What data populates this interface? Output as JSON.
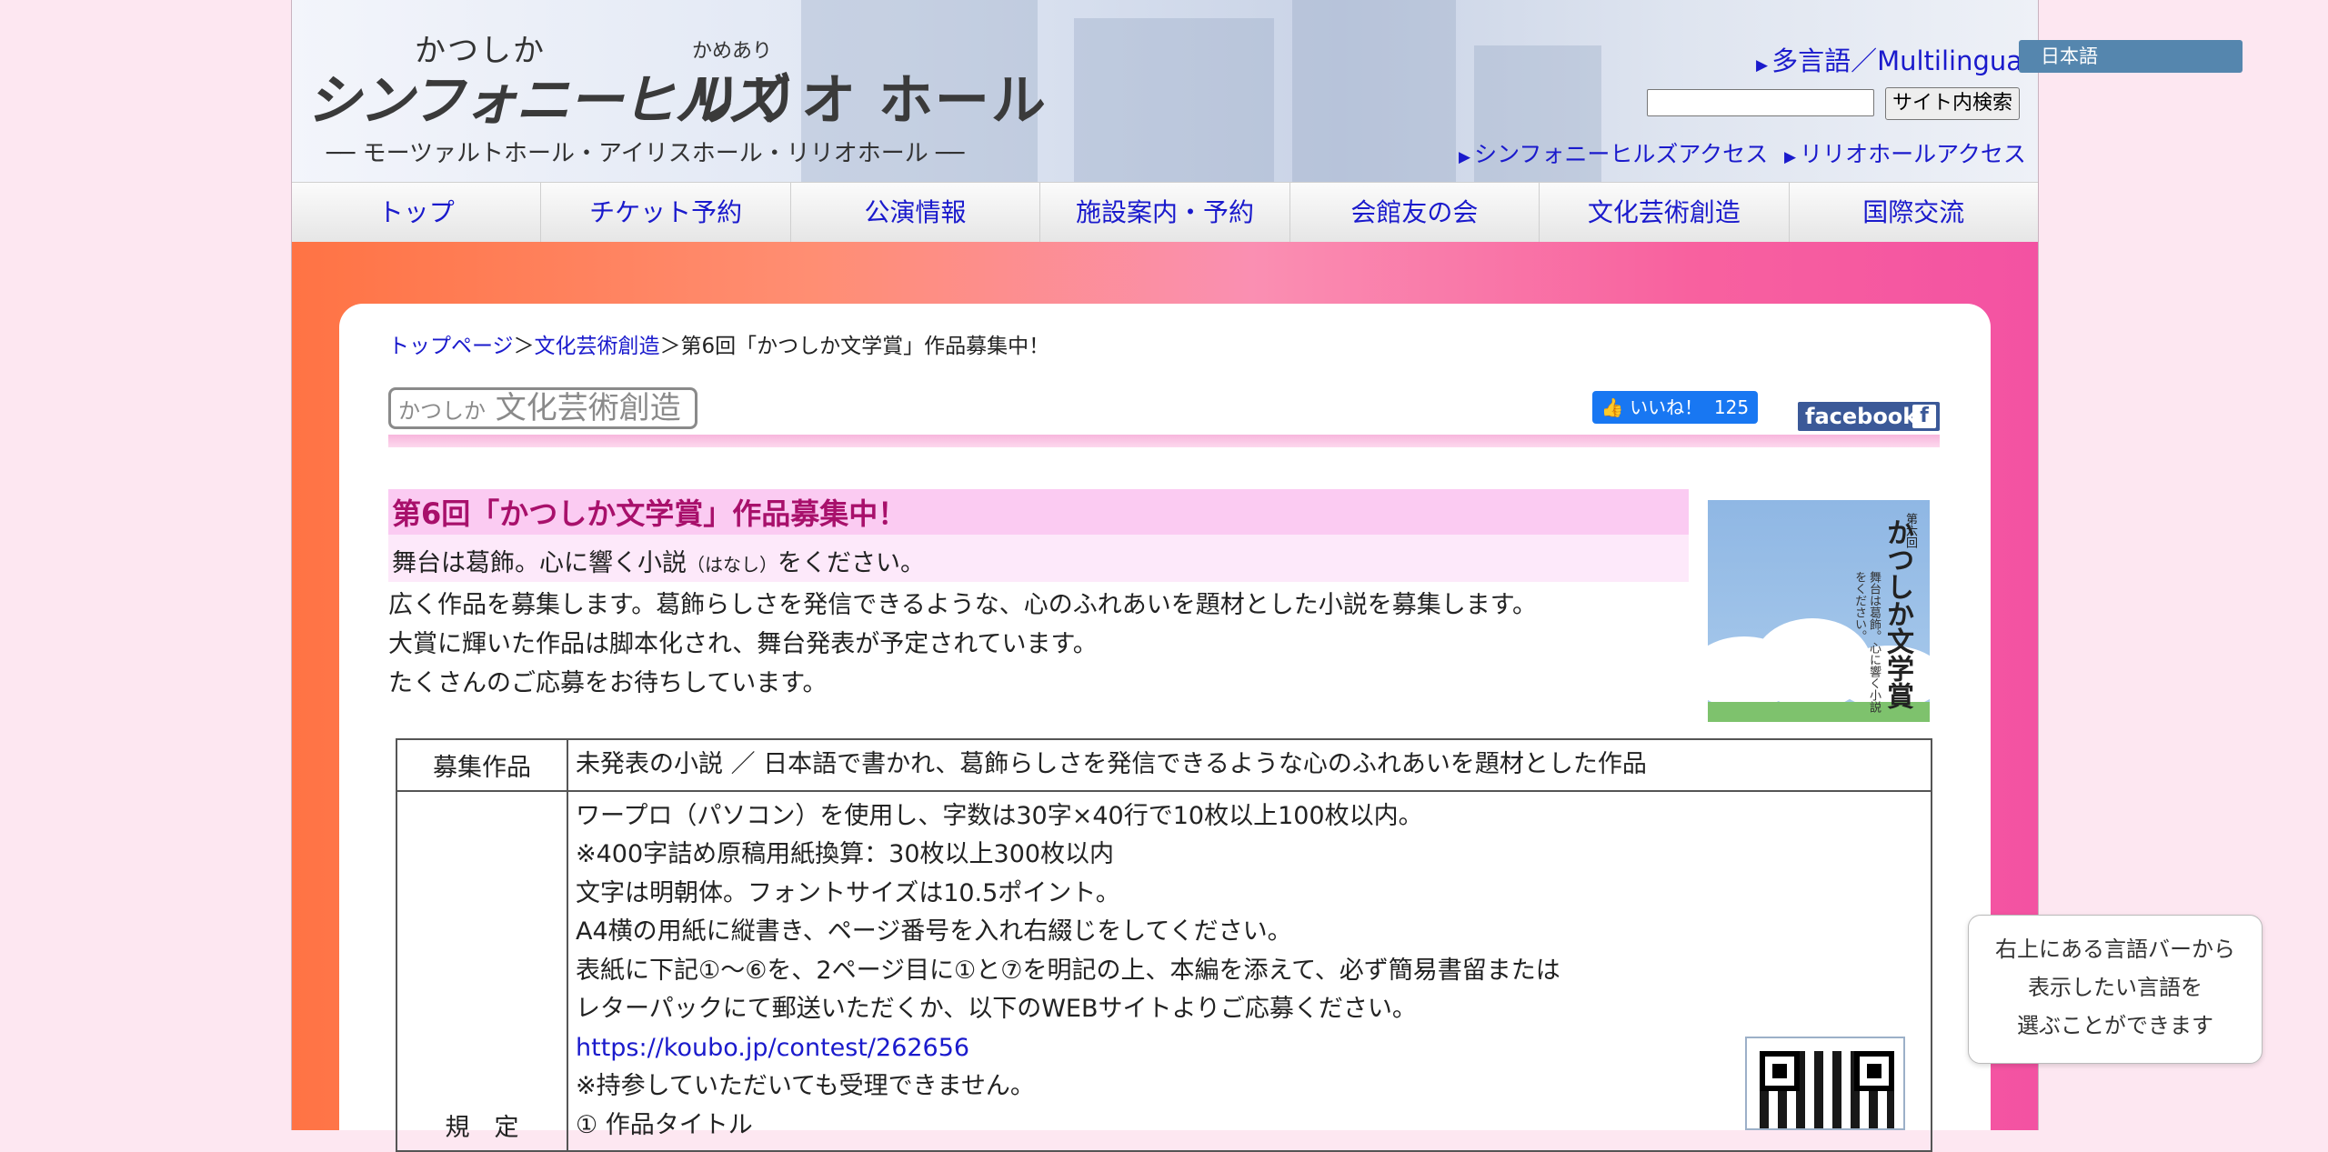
{
  "header": {
    "logo_line1": "かつしか",
    "logo_line2": "シンフォニーヒルズ",
    "logo_ruby": "かめあり",
    "logo_hall": "リリオ ホール",
    "logo_sub": "── モーツァルトホール・アイリスホール・リリオホール ──",
    "multilingual_link": "多言語／Multilingual",
    "language_bar": "日本語",
    "search_button": "サイト内検索",
    "access_links": [
      "シンフォニーヒルズアクセス",
      "リリオホールアクセス"
    ]
  },
  "nav": {
    "items": [
      "トップ",
      "チケット予約",
      "公演情報",
      "施設案内・予約",
      "会館友の会",
      "文化芸術創造",
      "国際交流"
    ]
  },
  "breadcrumb": {
    "home": "トップページ",
    "separator": "＞",
    "section": "文化芸術創造",
    "current": "第6回「かつしか文学賞」作品募集中！"
  },
  "section_logo": {
    "small": "かつしか",
    "main": " 文化芸術創造"
  },
  "social": {
    "like_label": "いいね！",
    "like_count": "125",
    "facebook_label": "facebook",
    "facebook_f": "f"
  },
  "article": {
    "title": "第6回「かつしか文学賞」作品募集中！",
    "subtitle_a": "舞台は葛飾。心に響く小説",
    "subtitle_ruby": "（はなし）",
    "subtitle_b": "をください。",
    "intro": [
      "広く作品を募集します。葛飾らしさを発信できるような、心のふれあいを題材とした小説を募集します。",
      "大賞に輝いた作品は脚本化され、舞台発表が予定されています。",
      "たくさんのご応募をお待ちしています。"
    ],
    "poster": {
      "vol": "第六回",
      "title": "かつしか文学賞",
      "sub": "舞台は葛飾。心に響く小説をください。"
    }
  },
  "table": {
    "rows": [
      {
        "header": "募集作品",
        "lines": [
          "未発表の小説 ／ 日本語で書かれ、葛飾らしさを発信できるような心のふれあいを題材とした作品"
        ]
      },
      {
        "header": "規　定",
        "lines": [
          "ワープロ（パソコン）を使用し、字数は30字×40行で10枚以上100枚以内。",
          "※400字詰め原稿用紙換算：30枚以上300枚以内",
          "文字は明朝体。フォントサイズは10.5ポイント。",
          "A4横の用紙に縦書き、ページ番号を入れ右綴じをしてください。",
          "表紙に下記①～⑥を、2ページ目に①と⑦を明記の上、本編を添えて、必ず簡易書留または",
          "レターパックにて郵送いただくか、以下のWEBサイトよりご応募ください。"
        ],
        "link": "https://koubo.jp/contest/262656",
        "lines_after": [
          "※持参していただいても受理できません。",
          "① 作品タイトル"
        ]
      }
    ]
  },
  "tooltip": {
    "lines": [
      "右上にある言語バーから",
      "表示したい言語を",
      "選ぶことができます"
    ]
  },
  "colors": {
    "link": "#1a1acc",
    "title": "#a8106b",
    "language_bar": "#5586ae",
    "facebook": "#3b5998",
    "like": "#1877f2"
  }
}
